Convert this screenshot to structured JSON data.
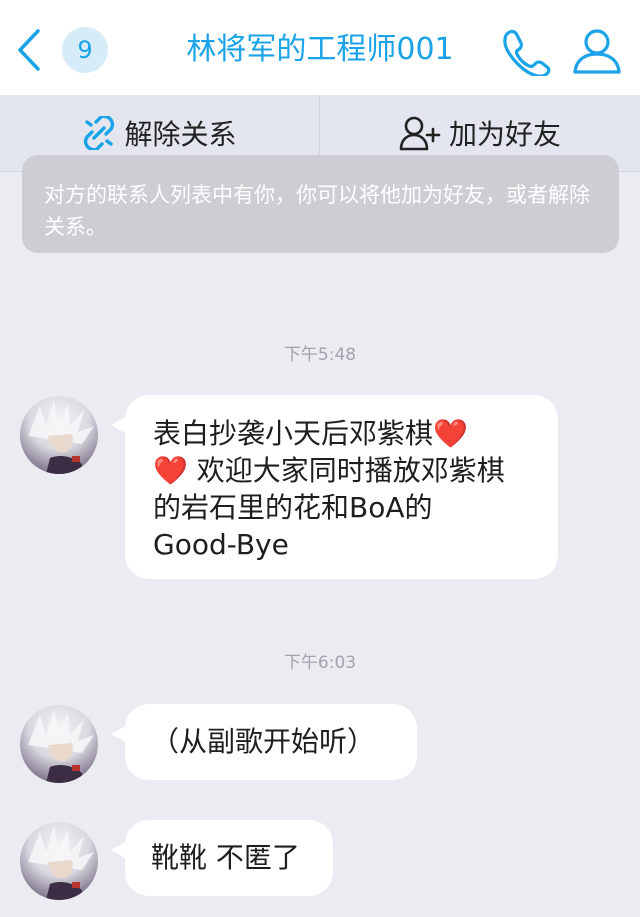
{
  "header": {
    "badge_count": "9",
    "title": "林将军的工程师001",
    "accent_color": "#1aa3e8",
    "icons": [
      "back-chevron-icon",
      "phone-icon",
      "person-icon"
    ]
  },
  "actions": {
    "unlink_label": "解除关系",
    "add_friend_label": "加为好友"
  },
  "notice": {
    "text": "对方的联系人列表中有你，你可以将他加为好友，或者解除关系。"
  },
  "messages": [
    {
      "time": "下午5:48",
      "line1": "表白抄袭小天后邓紫棋",
      "heart1": "❤️",
      "heart2": "❤️",
      "line2": "欢迎大家同时播放邓紫棋",
      "line3": "的岩石里的花和BoA的",
      "line4": "Good-Bye"
    },
    {
      "time": "下午6:03",
      "text": "（从副歌开始听）"
    },
    {
      "text": "靴靴 不匿了"
    }
  ]
}
